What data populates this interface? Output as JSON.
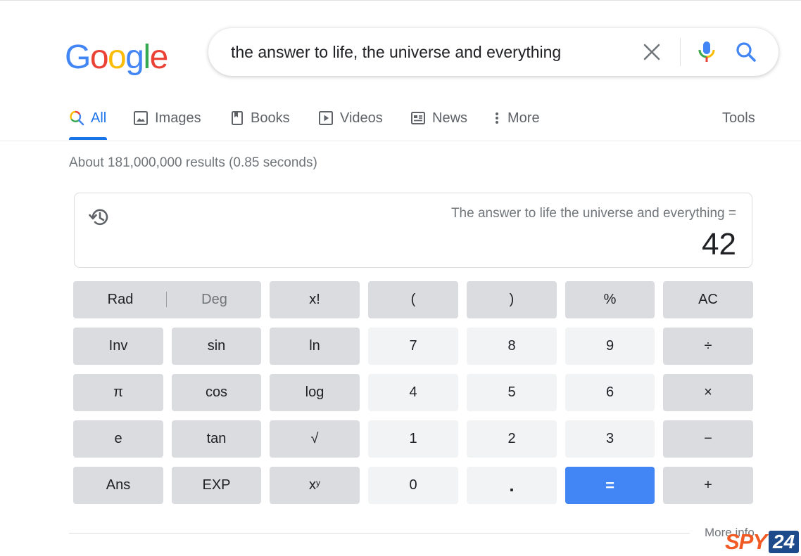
{
  "logo": {
    "letters": [
      "G",
      "o",
      "o",
      "g",
      "l",
      "e"
    ],
    "colors": [
      "#4285f4",
      "#ea4335",
      "#fbbc05",
      "#4285f4",
      "#34a853",
      "#ea4335"
    ]
  },
  "search": {
    "query": "the answer to life, the universe and everything"
  },
  "tabs": [
    {
      "label": "All",
      "icon": "search-icon",
      "active": true
    },
    {
      "label": "Images",
      "icon": "image-icon"
    },
    {
      "label": "Books",
      "icon": "book-icon"
    },
    {
      "label": "Videos",
      "icon": "video-icon"
    },
    {
      "label": "News",
      "icon": "news-icon"
    },
    {
      "label": "More",
      "icon": "more-vert-icon"
    }
  ],
  "tools_label": "Tools",
  "result_stats": "About 181,000,000 results (0.85 seconds)",
  "calculator": {
    "expression": "The answer to life the universe and everything =",
    "result": "42",
    "rad_label": "Rad",
    "deg_label": "Deg",
    "keys": {
      "fact": "x!",
      "lparen": "(",
      "rparen": ")",
      "percent": "%",
      "ac": "AC",
      "inv": "Inv",
      "sin": "sin",
      "ln": "ln",
      "seven": "7",
      "eight": "8",
      "nine": "9",
      "divide": "÷",
      "pi": "π",
      "cos": "cos",
      "log": "log",
      "four": "4",
      "five": "5",
      "six": "6",
      "multiply": "×",
      "e": "e",
      "tan": "tan",
      "sqrt": "√",
      "one": "1",
      "two": "2",
      "three": "3",
      "minus": "−",
      "ans": "Ans",
      "exp": "EXP",
      "pow_base": "x",
      "pow_exp": "y",
      "zero": "0",
      "dot": ".",
      "equals": "=",
      "plus": "+"
    }
  },
  "more_info": "More info",
  "watermark": {
    "part1": "SPY",
    "part2": "24"
  },
  "colors": {
    "accent": "#1a73e8",
    "equals_key": "#4285f4",
    "func_key": "#dadce0",
    "num_key": "#f1f3f4"
  }
}
